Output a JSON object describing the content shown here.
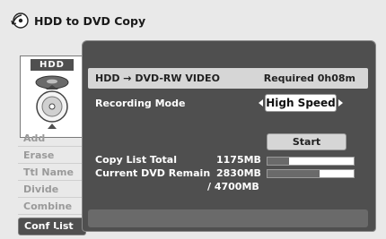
{
  "window": {
    "title": "HDD to DVD Copy",
    "title_icon": "disc-copy-icon"
  },
  "sidebar": {
    "hdd_label": "HDD",
    "items": [
      {
        "label": "Add",
        "active": false
      },
      {
        "label": "Erase",
        "active": false
      },
      {
        "label": "Ttl Name",
        "active": false
      },
      {
        "label": "Divide",
        "active": false
      },
      {
        "label": "Combine",
        "active": false
      },
      {
        "label": "Conf List",
        "active": true
      }
    ]
  },
  "main": {
    "header": {
      "source_dest": "HDD → DVD-RW VIDEO",
      "required": "Required 0h08m"
    },
    "recording_mode": {
      "label": "Recording Mode",
      "value": "High Speed"
    },
    "start_label": "Start",
    "copy_list_total": {
      "label": "Copy List Total",
      "value": "1175MB",
      "fraction": 0.25
    },
    "current_dvd_remain": {
      "label": "Current DVD Remain",
      "value": "2830MB",
      "total": "/ 4700MB",
      "fraction": 0.6
    }
  },
  "colors": {
    "panel_bg": "#4f4f4f",
    "header_bg": "#d6d6d6",
    "menu_inactive": "#9a9a9a",
    "menu_active_bg": "#505050"
  }
}
